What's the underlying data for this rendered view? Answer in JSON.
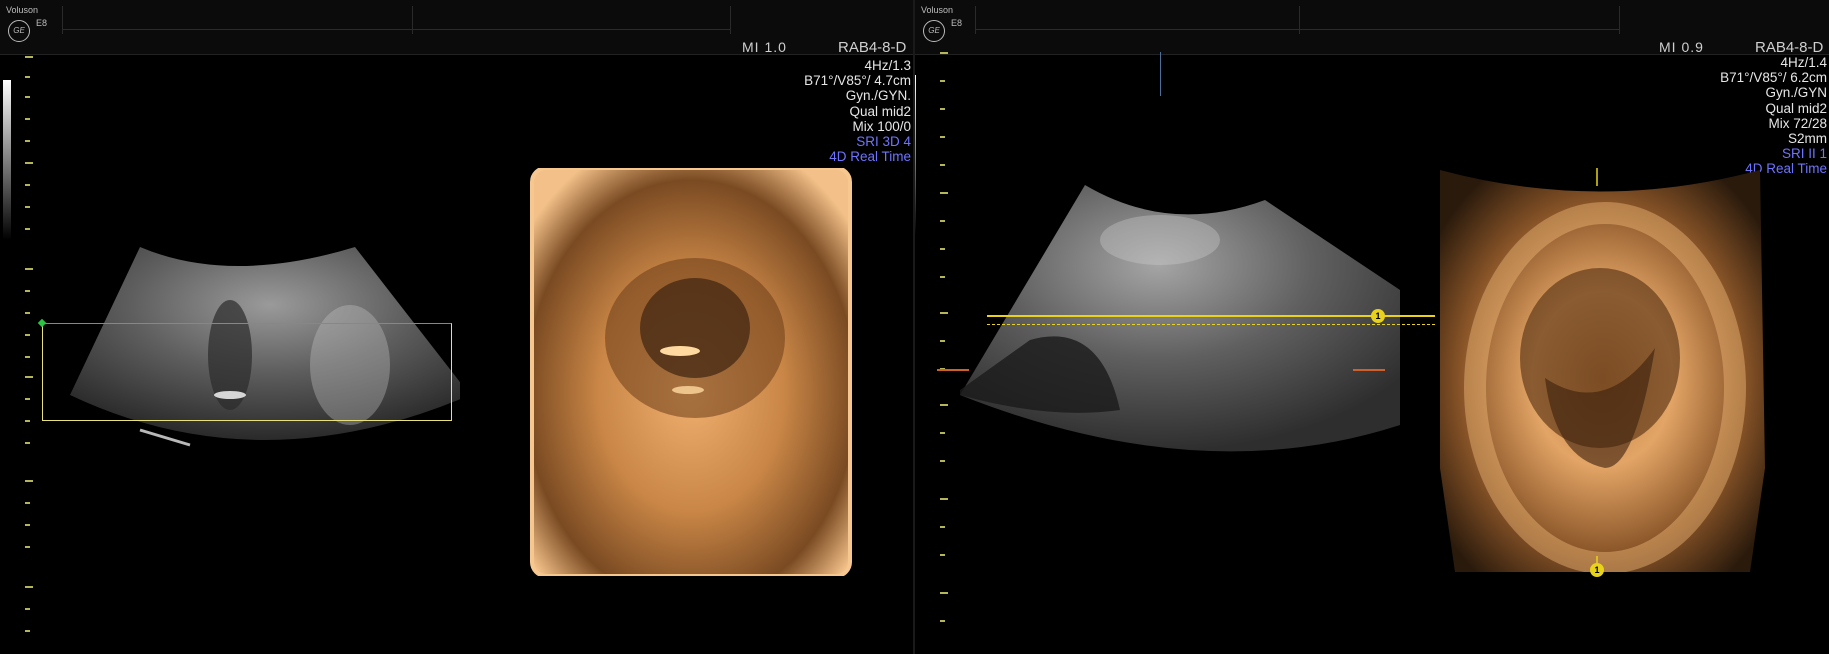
{
  "left": {
    "brand": "Voluson",
    "model": "E8",
    "logo_text": "GE",
    "mi": "MI  1.0",
    "probe": "RAB4-8-D",
    "params": [
      "4Hz/1.3",
      "B71°/V85°/ 4.7cm",
      "Gyn./GYN.",
      "Qual mid2",
      "Mix 100/0"
    ],
    "params_blue": [
      "SRI 3D 4",
      "4D Real Time"
    ]
  },
  "right": {
    "brand": "Voluson",
    "model": "E8",
    "logo_text": "GE",
    "mi": "MI  0.9",
    "probe": "RAB4-8-D",
    "params": [
      "4Hz/1.4",
      "B71°/V85°/ 6.2cm",
      "Gyn./GYN",
      "Qual mid2",
      "Mix 72/28",
      "S2mm"
    ],
    "params_blue": [
      "SRI II 1",
      "4D Real Time"
    ],
    "marker_label": "1"
  },
  "colors": {
    "accent_blue": "#6f74ff",
    "roi_green": "#29c441",
    "roi_yellow": "#e8e07a",
    "plane_yellow": "#e8d21a",
    "render_orange": "#c98646"
  }
}
